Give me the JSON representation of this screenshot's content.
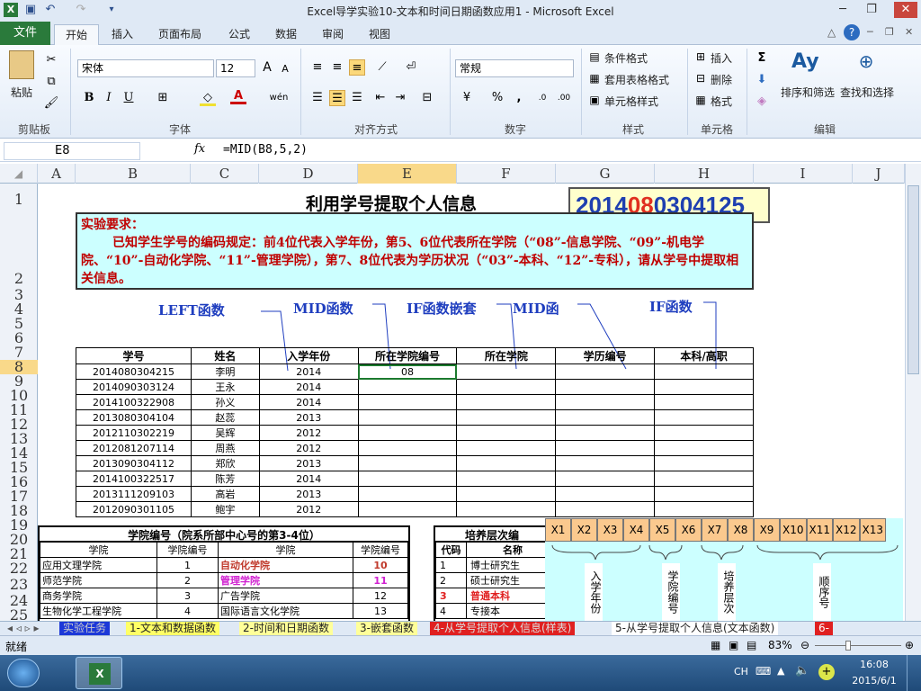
{
  "window": {
    "title": "Excel导学实验10-文本和时间日期函数应用1  -  Microsoft Excel"
  },
  "ribbon": {
    "tabs": [
      "文件",
      "开始",
      "插入",
      "页面布局",
      "公式",
      "数据",
      "审阅",
      "视图"
    ],
    "clipboard": {
      "paste": "粘贴",
      "group": "剪贴板"
    },
    "font": {
      "name": "宋体",
      "size": "12",
      "group": "字体",
      "grow": "A",
      "shrink": "A",
      "bold": "B",
      "italic": "I",
      "underline": "U",
      "wen": "wén"
    },
    "alignment": {
      "group": "对齐方式"
    },
    "number": {
      "format": "常规",
      "group": "数字",
      "percent": "%",
      "comma": ","
    },
    "styles": {
      "conditional": "条件格式",
      "table": "套用表格格式",
      "cell": "单元格样式",
      "group": "样式"
    },
    "cells": {
      "insert": "插入",
      "delete": "删除",
      "format": "格式",
      "group": "单元格"
    },
    "editing": {
      "sigma": "Σ",
      "sort": "排序和筛选",
      "find": "查找和选择",
      "group": "编辑"
    }
  },
  "formula_bar": {
    "name_box": "E8",
    "fx": "fx",
    "formula": "=MID(B8,5,2)"
  },
  "columns": [
    "A",
    "B",
    "C",
    "D",
    "E",
    "F",
    "G",
    "H",
    "I",
    "J"
  ],
  "rows": [
    "1",
    "2",
    "3",
    "4",
    "5",
    "6",
    "7",
    "8",
    "9",
    "10",
    "11",
    "12",
    "13",
    "14",
    "15",
    "16",
    "17",
    "18",
    "19",
    "20",
    "21",
    "22",
    "23",
    "24",
    "25"
  ],
  "sheet": {
    "title": "利用学号提取个人信息",
    "id_display": {
      "p1": "2014",
      "p2": "08",
      "p3": "03",
      "p4": "04125"
    },
    "requirement_head": "实验要求：",
    "requirement_body": "已知学生学号的编码规定：前4位代表入学年份，第5、6位代表所在学院（“08”-信息学院、“09”-机电学院、“10”-自动化学院、“11”-管理学院），第7、8位代表为学历状况（“03”-本科、“12”-专科），请从学号中提取相关信息。",
    "callouts": [
      "LEFT函数",
      "MID函数",
      "IF函数嵌套",
      "MID函",
      "IF函数"
    ],
    "headers": [
      "学号",
      "姓名",
      "入学年份",
      "所在学院编号",
      "所在学院",
      "学历编号",
      "本科/高职"
    ],
    "records": [
      [
        "2014080304215",
        "李明",
        "2014",
        "08",
        "",
        "",
        ""
      ],
      [
        "2014090303124",
        "王永",
        "2014",
        "",
        "",
        "",
        ""
      ],
      [
        "2014100322908",
        "孙义",
        "2014",
        "",
        "",
        "",
        ""
      ],
      [
        "2013080304104",
        "赵蕊",
        "2013",
        "",
        "",
        "",
        ""
      ],
      [
        "2012110302219",
        "吴辉",
        "2012",
        "",
        "",
        "",
        ""
      ],
      [
        "2012081207114",
        "周燕",
        "2012",
        "",
        "",
        "",
        ""
      ],
      [
        "2013090304112",
        "郑欣",
        "2013",
        "",
        "",
        "",
        ""
      ],
      [
        "2014100322517",
        "陈芳",
        "2014",
        "",
        "",
        "",
        ""
      ],
      [
        "2013111209103",
        "高岩",
        "2013",
        "",
        "",
        "",
        ""
      ],
      [
        "2012090301105",
        "鲍宇",
        "2012",
        "",
        "",
        "",
        ""
      ]
    ],
    "college_table": {
      "title": "学院编号（院系所部中心号的第3-4位）",
      "headers": [
        "学院",
        "学院编号",
        "学院",
        "学院编号"
      ],
      "rows": [
        [
          "应用文理学院",
          "1",
          "自动化学院",
          "10"
        ],
        [
          "师范学院",
          "2",
          "管理学院",
          "11"
        ],
        [
          "商务学院",
          "3",
          "广告学院",
          "12"
        ],
        [
          "生物化学工程学院",
          "4",
          "国际语言文化学院",
          "13"
        ]
      ]
    },
    "level_table": {
      "title": "培养层次编",
      "headers": [
        "代码",
        "名称"
      ],
      "rows": [
        [
          "1",
          "博士研究生"
        ],
        [
          "2",
          "硕士研究生"
        ],
        [
          "3",
          "普通本科"
        ],
        [
          "4",
          "专接本"
        ]
      ]
    },
    "digit_boxes": [
      "X1",
      "X2",
      "X3",
      "X4",
      "X5",
      "X6",
      "X7",
      "X8",
      "X9",
      "X10",
      "X11",
      "X12",
      "X13"
    ],
    "digit_labels": [
      "入学年份",
      "学院编号",
      "培养层次",
      "顺序号"
    ]
  },
  "sheet_tabs": [
    "实验任务",
    "1-文本和数据函数",
    "2-时间和日期函数",
    "3-嵌套函数",
    "4-从学号提取个人信息(样表)",
    "5-从学号提取个人信息(文本函数)",
    "6-"
  ],
  "status": {
    "ready": "就绪",
    "zoom": "83%"
  },
  "taskbar": {
    "lang": "CH",
    "time": "16:08",
    "date": "2015/6/1"
  },
  "colors": {
    "excel_green": "#2a7a3b",
    "req_bg": "#ccffff",
    "req_text": "#c00000",
    "callout_blue": "#1f3ebf",
    "id_blue": "#1e3fb0",
    "id_red": "#e03020",
    "selection": "#1c7a2e"
  }
}
